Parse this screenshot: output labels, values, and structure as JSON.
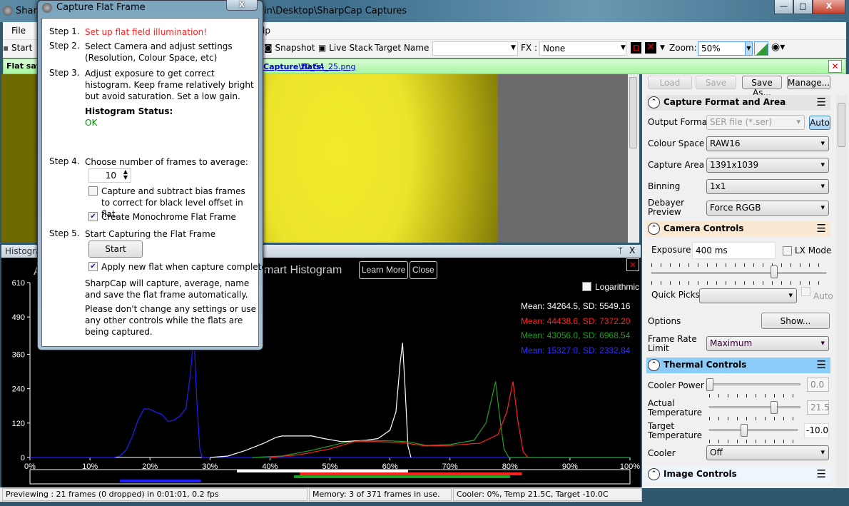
{
  "window": {
    "title": "SharpCap",
    "title_path": "in\\Desktop\\SharpCap Captures",
    "minimize": "—",
    "maximize": "□",
    "close": "X"
  },
  "menu": {
    "file": "File",
    "help_partial": "lp"
  },
  "toolbar": {
    "start": "Start",
    "snapshot": "Snapshot",
    "live_stack": "Live Stack",
    "target_name_label": "Target Name :",
    "target_name_value": "",
    "fx_label": "FX :",
    "fx_value": "None",
    "zoom_label": "Zoom:",
    "zoom_value": "50%"
  },
  "notice": {
    "prefix": "Flat save",
    "link1": "Capture\\flats\\",
    "link2": "20_54_25.png",
    "close": "✕"
  },
  "dialog": {
    "title": "Capture Flat Frame",
    "close": "X",
    "step1_label": "Step 1.",
    "step1_text": "Set up flat field illumination!",
    "step2_label": "Step 2.",
    "step2_text": "Select Camera and adjust settings (Resolution, Colour Space, etc)",
    "step3_label": "Step 3.",
    "step3_text": "Adjust exposure to get correct histogram. Keep frame relatively bright but avoid saturation. Set a low gain.",
    "hist_status_label": "Histogram Status:",
    "hist_status_value": "OK",
    "step4_label": "Step 4.",
    "step4_text": "Choose number of frames to average:",
    "frames": "10",
    "bias_label": "Capture and subtract bias frames to correct for black level offset in flat.",
    "bias_checked": false,
    "mono_label": "Create Monochrome Flat Frame",
    "mono_checked": true,
    "step5_label": "Step 5.",
    "step5_text": "Start Capturing the Flat Frame",
    "start_button": "Start",
    "apply_label": "Apply new flat when capture complete",
    "apply_checked": true,
    "info1": "SharpCap will capture, average, name and save the flat frame automatically.",
    "info2": "Please don't change any settings or use any other controls while the flats are being captured."
  },
  "histogram": {
    "panel_title": "Histogram",
    "pin": "ᛘ",
    "close": "X",
    "title_partial": "mart Histogram",
    "title_prefix": "A",
    "learn_more": "Learn More",
    "close_button": "Close",
    "logarithmic_label": "Logarithmic",
    "logarithmic_checked": false,
    "stats": [
      {
        "text": "Mean: 34264.5, SD: 5549.16",
        "color": "#ffffff"
      },
      {
        "text": "Mean: 44438.6, SD: 7372.20",
        "color": "#ff2020"
      },
      {
        "text": "Mean: 43056.0, SD: 6968.54",
        "color": "#20a020"
      },
      {
        "text": "Mean: 15327.0, SD: 2332.84",
        "color": "#3030ff"
      }
    ]
  },
  "chart_data": {
    "type": "line",
    "xlabel": "",
    "ylabel": "",
    "xlim": [
      0,
      100
    ],
    "ylim": [
      0,
      610
    ],
    "x_ticks": [
      "0%",
      "10%",
      "20%",
      "30%",
      "40%",
      "50%",
      "60%",
      "70%",
      "80%",
      "90%",
      "100%"
    ],
    "y_ticks": [
      "0",
      "120",
      "240",
      "360",
      "490",
      "610"
    ],
    "y_tick_values": [
      0,
      120,
      240,
      360,
      490,
      610
    ],
    "series": [
      {
        "color": "#2020ff",
        "points": [
          [
            0,
            0
          ],
          [
            14,
            0
          ],
          [
            15,
            5
          ],
          [
            16,
            25
          ],
          [
            17,
            70
          ],
          [
            18,
            130
          ],
          [
            19,
            170
          ],
          [
            20,
            168
          ],
          [
            21,
            158
          ],
          [
            22,
            150
          ],
          [
            23,
            126
          ],
          [
            24,
            130
          ],
          [
            25,
            145
          ],
          [
            26,
            170
          ],
          [
            26.8,
            300
          ],
          [
            27.3,
            440
          ],
          [
            27.8,
            200
          ],
          [
            28.3,
            30
          ],
          [
            28.7,
            0
          ],
          [
            100,
            0
          ]
        ],
        "range": [
          15,
          28.5
        ]
      },
      {
        "color": "#ffffff",
        "points": [
          [
            30,
            0
          ],
          [
            33,
            5
          ],
          [
            36,
            25
          ],
          [
            39,
            50
          ],
          [
            41,
            70
          ],
          [
            42,
            75
          ],
          [
            47,
            75
          ],
          [
            49,
            66
          ],
          [
            52,
            55
          ],
          [
            56,
            60
          ],
          [
            58,
            66
          ],
          [
            60,
            95
          ],
          [
            61,
            160
          ],
          [
            61.7,
            330
          ],
          [
            62.1,
            400
          ],
          [
            62.5,
            250
          ],
          [
            63,
            40
          ],
          [
            63.5,
            0
          ]
        ],
        "range": [
          34.5,
          63
        ]
      },
      {
        "color": "#20a020",
        "points": [
          [
            37,
            0
          ],
          [
            42,
            5
          ],
          [
            47,
            25
          ],
          [
            52,
            50
          ],
          [
            55,
            58
          ],
          [
            60,
            58
          ],
          [
            63,
            55
          ],
          [
            66,
            42
          ],
          [
            70,
            45
          ],
          [
            74,
            60
          ],
          [
            76,
            120
          ],
          [
            77,
            210
          ],
          [
            77.6,
            265
          ],
          [
            78.3,
            140
          ],
          [
            79,
            30
          ],
          [
            79.8,
            0
          ],
          [
            100,
            0
          ]
        ],
        "range": [
          44,
          80
        ]
      },
      {
        "color": "#ff2020",
        "points": [
          [
            40,
            0
          ],
          [
            45,
            10
          ],
          [
            50,
            30
          ],
          [
            54,
            55
          ],
          [
            58,
            55
          ],
          [
            62,
            52
          ],
          [
            66,
            40
          ],
          [
            70,
            42
          ],
          [
            75,
            50
          ],
          [
            78,
            80
          ],
          [
            79.5,
            160
          ],
          [
            80.5,
            265
          ],
          [
            81.3,
            130
          ],
          [
            82.2,
            20
          ],
          [
            83,
            0
          ]
        ],
        "range": [
          45,
          82
        ]
      }
    ]
  },
  "panel": {
    "load": "Load",
    "save": "Save",
    "save_as": "Save As...",
    "manage": "Manage...",
    "capture_format": {
      "title": "Capture Format and Area",
      "output_format_label": "Output Format",
      "output_format": "SER file (*.ser)",
      "auto": "Auto",
      "colour_space_label": "Colour Space",
      "colour_space": "RAW16",
      "capture_area_label": "Capture Area",
      "capture_area": "1391x1039",
      "binning_label": "Binning",
      "binning": "1x1",
      "debayer_label": "Debayer Preview",
      "debayer": "Force RGGB"
    },
    "camera_controls": {
      "title": "Camera Controls",
      "exposure_label": "Exposure",
      "exposure": "400 ms",
      "exposure_slider": 0.7,
      "lx_mode": "LX Mode",
      "quick_picks_label": "Quick Picks",
      "quick_picks": "",
      "auto": "Auto",
      "options_label": "Options",
      "show": "Show...",
      "frame_rate_label": "Frame Rate Limit",
      "frame_rate": "Maximum"
    },
    "thermal": {
      "title": "Thermal Controls",
      "cooler_power_label": "Cooler Power",
      "cooler_power": "0.0",
      "actual_temp_label": "Actual Temperature",
      "actual_temp": "21.5",
      "target_temp_label": "Target Temperature",
      "target_temp": "-10.0",
      "cooler_label": "Cooler",
      "cooler": "Off"
    },
    "image_controls": {
      "title": "Image Controls"
    },
    "accent_thermal": "#8cccf8",
    "accent_camera": "#fbe8d2"
  },
  "status": {
    "preview": "Previewing : 21 frames (0 dropped) in 0:01:01, 0.2 fps",
    "memory": "Memory: 3 of 371 frames in use.",
    "cooler": "Cooler: 0%, Temp 21.5C, Target -10.0C"
  }
}
